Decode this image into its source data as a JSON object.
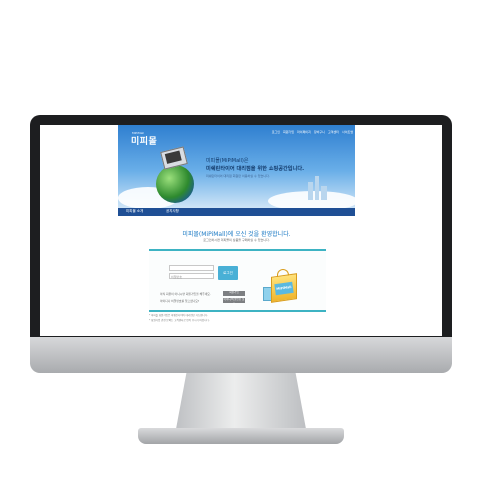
{
  "site": {
    "logo_small": "MiPiMall",
    "logo": "미피몰",
    "top_links": [
      "로그인",
      "회원가입",
      "마이페이지",
      "장바구니",
      "고객센터",
      "사이트맵"
    ],
    "hero": {
      "line1": "미피몰(MiPiMall)은",
      "line2": "미쉐린타이어 대리점을 위한 쇼핑공간입니다.",
      "line3": "미쉐린타이어 대리점 회원만 이용하실 수 있습니다."
    },
    "nav": [
      "미피몰 소개",
      "공지사항"
    ],
    "welcome_title": "미피몰(MiPiMall)에 오신 것을 환영합니다.",
    "welcome_sub": "로그인하시면 미피몰의 상품을 구매하실 수 있습니다.",
    "login": {
      "id_placeholder": "",
      "pw_placeholder": "비밀번호",
      "login_button": "로그인",
      "save_id": "아이디 저장",
      "help1": "아직 회원이 아니시면 회원가입을 해주세요.",
      "help2": "아이디나 비밀번호를 잊으셨나요?",
      "join_button": "회원가입",
      "find_button": "아이디/비밀번호 찾기",
      "bag_label": "MiPiMall"
    },
    "footnotes": [
      "* 미피몰 회원가입은 미쉐린타이어 대리점만 가능합니다.",
      "* 회원가입 관련 문의는 고객센터로 연락 주시기 바랍니다."
    ]
  },
  "colors": {
    "hero_blue": "#2f7fd0",
    "nav_blue": "#1f4f95",
    "accent_teal": "#3db3c3",
    "login_button": "#49b0d6",
    "welcome_text": "#1a79c4"
  }
}
